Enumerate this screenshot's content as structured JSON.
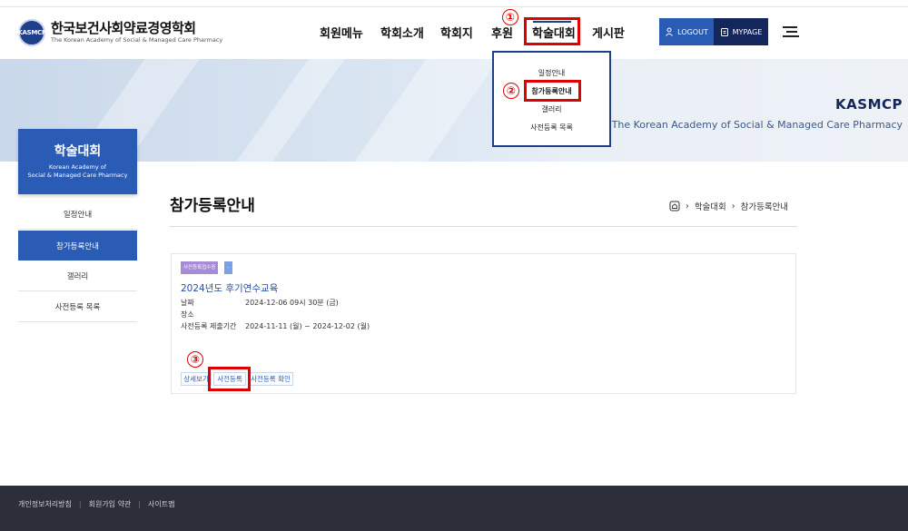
{
  "site": {
    "logo_emblem": "KASMCP",
    "logo_title": "한국보건사회약료경영학회",
    "logo_subtitle": "The Korean Academy of Social & Managed Care Pharmacy"
  },
  "nav": {
    "items": [
      {
        "label": "회원메뉴"
      },
      {
        "label": "학회소개"
      },
      {
        "label": "학회지"
      },
      {
        "label": "후원"
      },
      {
        "label": "학술대회"
      },
      {
        "label": "게시판"
      }
    ],
    "logout_label": "LOGOUT",
    "mypage_label": "MYPAGE"
  },
  "dropdown": {
    "items": [
      {
        "label": "일정안내"
      },
      {
        "label": "참가등록안내"
      },
      {
        "label": "갤러리"
      },
      {
        "label": "사전등록 목록"
      }
    ]
  },
  "banner": {
    "title": "KASMCP",
    "subtitle": "The Korean Academy of Social & Managed Care Pharmacy"
  },
  "sidebar": {
    "title": "학술대회",
    "subtitle_line1": "Korean Academy of",
    "subtitle_line2": "Social & Managed Care Pharmacy",
    "items": [
      {
        "label": "일정안내"
      },
      {
        "label": "참가등록안내"
      },
      {
        "label": "갤러리"
      },
      {
        "label": "사전등록 목록"
      }
    ]
  },
  "page": {
    "title": "참가등록안내",
    "breadcrumb": [
      "학술대회",
      "참가등록안내"
    ]
  },
  "event": {
    "tag": "사전등록접수중",
    "tag_extra": "-",
    "title": "2024년도 후기연수교육",
    "date_label": "날짜",
    "date_value": "2024-12-06 09시 30분 (금)",
    "place_label": "장소",
    "period_label": "사전등록 제출기간",
    "period_value": "2024-11-11 (월) ~ 2024-12-02 (월)",
    "buttons": [
      {
        "label": "상세보기"
      },
      {
        "label": "사전등록"
      },
      {
        "label": "사전등록 확인"
      }
    ]
  },
  "annotations": {
    "mark1": "①",
    "mark2": "②",
    "mark3": "③"
  },
  "footer": {
    "links": [
      {
        "label": "개인정보처리방침"
      },
      {
        "label": "회원가입 약관"
      },
      {
        "label": "사이트맵"
      }
    ]
  },
  "colors": {
    "primary": "#2a5bb5",
    "navy": "#14275c",
    "highlight": "#e00000"
  }
}
